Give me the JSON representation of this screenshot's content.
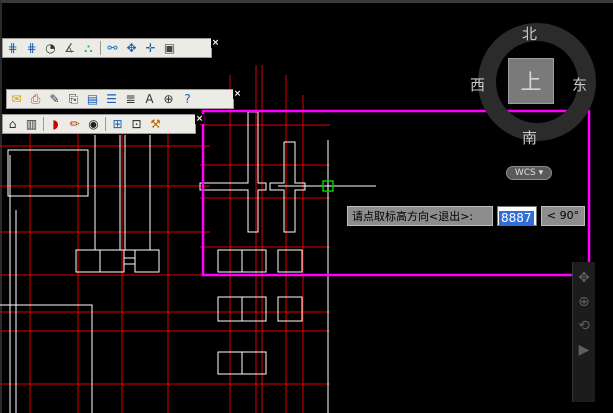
{
  "compass": {
    "north": "北",
    "south": "南",
    "west": "西",
    "east": "东",
    "top": "上",
    "wcs": "WCS ▾"
  },
  "command": {
    "prompt": "请点取标高方向<退出>:",
    "value": "8887",
    "angle": "< 90°"
  },
  "toolbars": [
    {
      "icons": [
        "grid-snap-icon",
        "grid-snap-2-icon",
        "dimension-circle-icon",
        "angle-icon",
        "layer-icon",
        "sep",
        "link-icon",
        "move-icon",
        "pan-icon",
        "palette-icon"
      ]
    },
    {
      "icons": [
        "envelope-icon",
        "print-icon",
        "edit-icon",
        "clip-icon",
        "table-icon",
        "list-icon",
        "text-align-icon",
        "text-icon",
        "target-icon",
        "help-icon"
      ]
    },
    {
      "icons": [
        "tool-icon",
        "building-icon",
        "sep",
        "eraser-icon",
        "pen-icon",
        "eye-icon",
        "sep",
        "grid-icon",
        "frame-icon",
        "brush-icon"
      ]
    }
  ],
  "colors": {
    "red": "#e00000",
    "white": "#ffffff",
    "selection": "#ff00ff",
    "cursor": "#00cc00"
  }
}
